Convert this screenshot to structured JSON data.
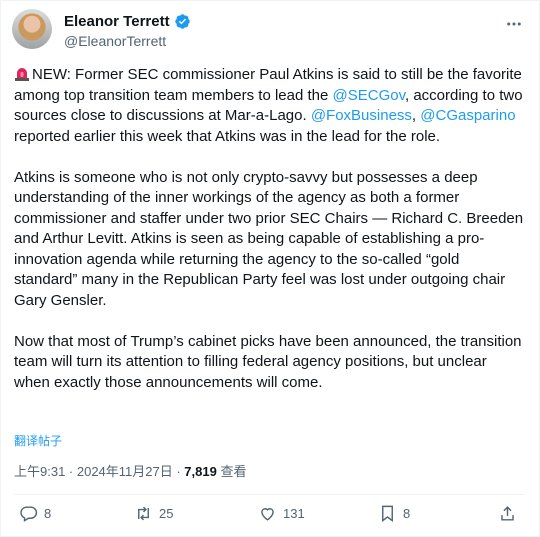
{
  "author": {
    "display_name": "Eleanor Terrett",
    "handle": "@EleanorTerrett"
  },
  "tweet": {
    "p1": {
      "intro": "NEW: Former SEC commissioner Paul Atkins is said to still be the favorite among top transition team members to lead the ",
      "mention1": "@SECGov",
      "after1": ", according to two sources close to discussions at Mar-a-Lago.",
      "mention2": "@FoxBusiness",
      "sep": ", ",
      "mention3": "@CGasparino",
      "after3": " reported earlier this week that Atkins was in the lead for the role."
    },
    "p2": "Atkins is someone who is not only crypto-savvy but possesses a deep understanding of the inner workings of the agency as both a former commissioner and staffer under two prior SEC Chairs — Richard C. Breeden and Arthur Levitt. Atkins is seen as being capable of establishing a pro-innovation agenda while returning the agency to the so-called “gold standard” many in the Republican Party feel was lost under outgoing chair Gary Gensler.",
    "p3": "Now that most of Trump’s cabinet picks have been announced, the transition team will turn its attention to filling federal agency positions, but unclear when exactly those announcements will come.",
    "translate_label": "翻译帖子"
  },
  "meta": {
    "time_date": "上午9:31 · 2024年11月27日 · ",
    "views_count": "7,819",
    "views_label": " 查看"
  },
  "actions": {
    "replies": "8",
    "reposts": "25",
    "likes": "131",
    "bookmarks": "8"
  },
  "icons": [
    "verified-badge-icon",
    "more-icon",
    "siren-emoji-icon",
    "reply-icon",
    "repost-icon",
    "like-icon",
    "bookmark-icon",
    "share-icon"
  ],
  "colors": {
    "link": "#1d9bf0",
    "secondary_text": "#536471",
    "verified": "#1d9bf0"
  }
}
